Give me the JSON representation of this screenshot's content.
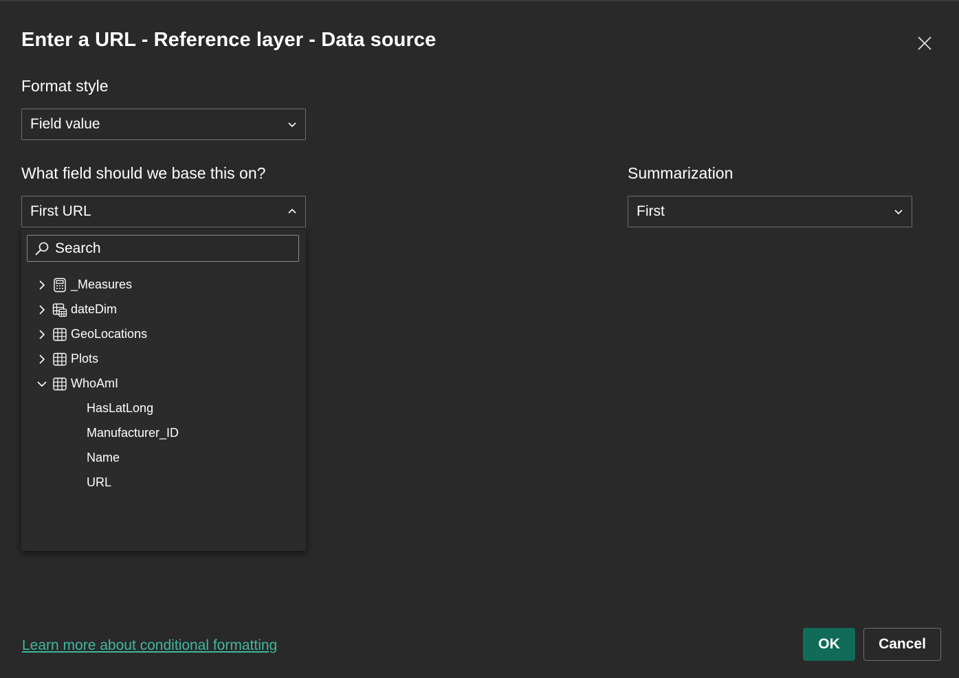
{
  "dialog": {
    "title": "Enter a URL - Reference layer - Data source",
    "close_icon": "close-icon"
  },
  "format_style": {
    "label": "Format style",
    "value": "Field value"
  },
  "base_field": {
    "label": "What field should we base this on?",
    "value": "First URL",
    "expanded": true
  },
  "summarization": {
    "label": "Summarization",
    "value": "First"
  },
  "field_list": {
    "search_placeholder": "Search",
    "tables": [
      {
        "label": "_Measures",
        "icon": "calculator-icon",
        "expanded": false
      },
      {
        "label": "dateDim",
        "icon": "date-table-icon",
        "expanded": false
      },
      {
        "label": "GeoLocations",
        "icon": "table-icon",
        "expanded": false
      },
      {
        "label": "Plots",
        "icon": "table-icon",
        "expanded": false
      },
      {
        "label": "WhoAmI",
        "icon": "table-icon",
        "expanded": true
      }
    ],
    "fields": [
      "HasLatLong",
      "Manufacturer_ID",
      "Name",
      "URL"
    ]
  },
  "footer": {
    "learn_more_link": "Learn more about conditional formatting",
    "ok_label": "OK",
    "cancel_label": "Cancel"
  },
  "colors": {
    "background": "#292929",
    "accent": "#106b58",
    "link": "#3fb8a0",
    "border": "#6e6e6e"
  }
}
